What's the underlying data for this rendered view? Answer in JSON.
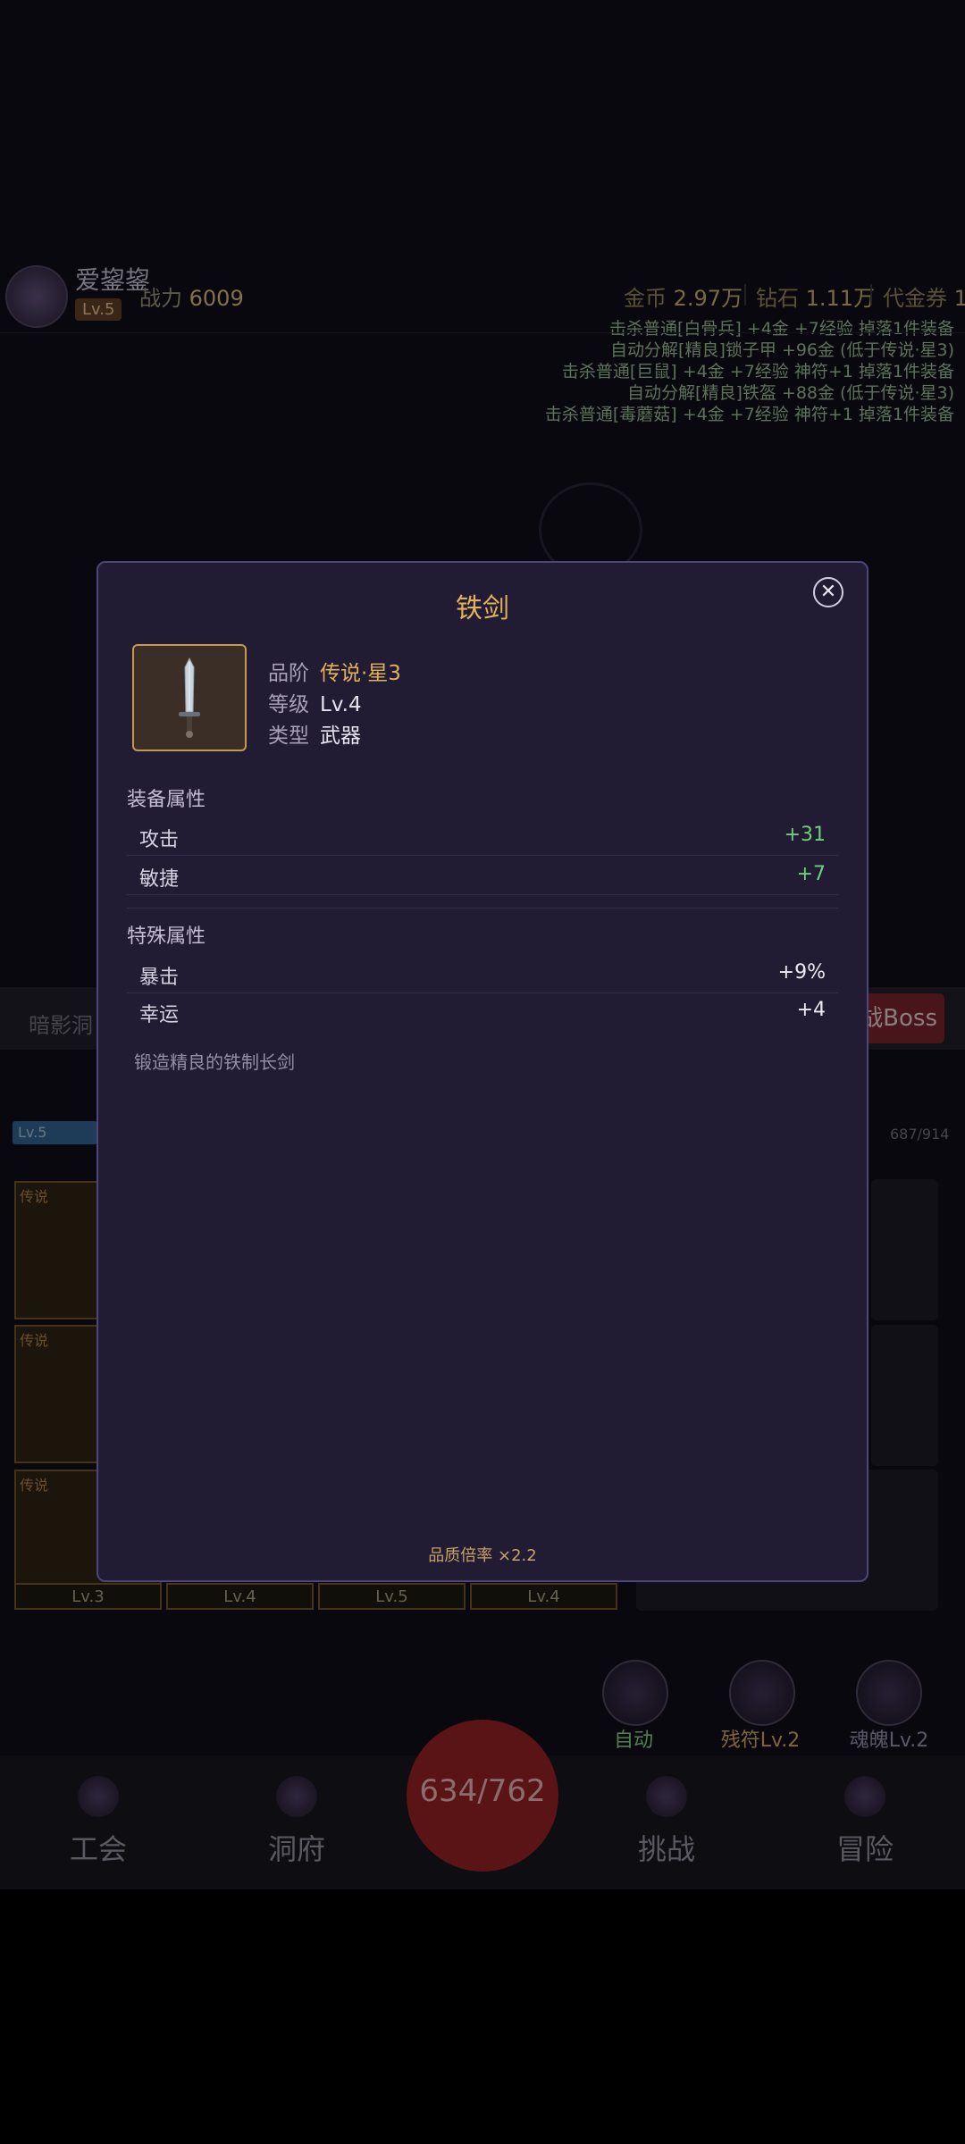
{
  "header": {
    "player_name": "爱鋆鋆",
    "player_level": "Lv.5",
    "power_label": "战力",
    "power_value": "6009",
    "gold_label": "金币",
    "gold_value": "2.97万",
    "diamond_label": "钻石",
    "diamond_value": "1.11万",
    "voucher_label": "代金券",
    "voucher_value": "1"
  },
  "battle_log": [
    "击杀普通[白骨兵] +4金 +7经验 掉落1件装备",
    "自动分解[精良]锁子甲 +96金 (低于传说·星3)",
    "击杀普通[巨鼠] +4金 +7经验 神符+1 掉落1件装备",
    "自动分解[精良]铁盔 +88金 (低于传说·星3)",
    "击杀普通[毒蘑菇] +4金 +7经验 神符+1 掉落1件装备"
  ],
  "dungeon": {
    "name": "暗影洞",
    "boss_button": "战Boss",
    "xp_level": "Lv.5",
    "xp_progress": "687/914"
  },
  "inventory": {
    "rarity": "传说",
    "slot_levels": [
      "Lv.",
      "Lv.",
      "Lv.3",
      "Lv.4",
      "Lv.5",
      "Lv.4"
    ]
  },
  "skills": [
    {
      "label": "自动",
      "color": "#7bc47f"
    },
    {
      "label": "残符Lv.2",
      "color": "#c89a5a"
    },
    {
      "label": "魂魄Lv.2",
      "color": "#8a86a0"
    }
  ],
  "nav": {
    "items": [
      "工会",
      "洞府",
      "挑战",
      "冒险"
    ],
    "center_counter": "634/762"
  },
  "modal": {
    "title": "铁剑",
    "close_icon": "close-icon",
    "grade_label": "品阶",
    "grade_value": "传说·星3",
    "level_label": "等级",
    "level_value": "Lv.4",
    "type_label": "类型",
    "type_value": "武器",
    "equip_section": "装备属性",
    "equip_stats": [
      {
        "name": "攻击",
        "value": "+31"
      },
      {
        "name": "敏捷",
        "value": "+7"
      }
    ],
    "special_section": "特殊属性",
    "special_stats": [
      {
        "name": "暴击",
        "value": "+9%"
      },
      {
        "name": "幸运",
        "value": "+4"
      }
    ],
    "description": "锻造精良的铁制长剑",
    "quality_multiplier": "品质倍率 ×2.2"
  },
  "colors": {
    "accent_gold": "#e3b15c",
    "stat_green": "#6fcf7c",
    "modal_bg": "#211b34",
    "modal_border": "#4e4578"
  }
}
